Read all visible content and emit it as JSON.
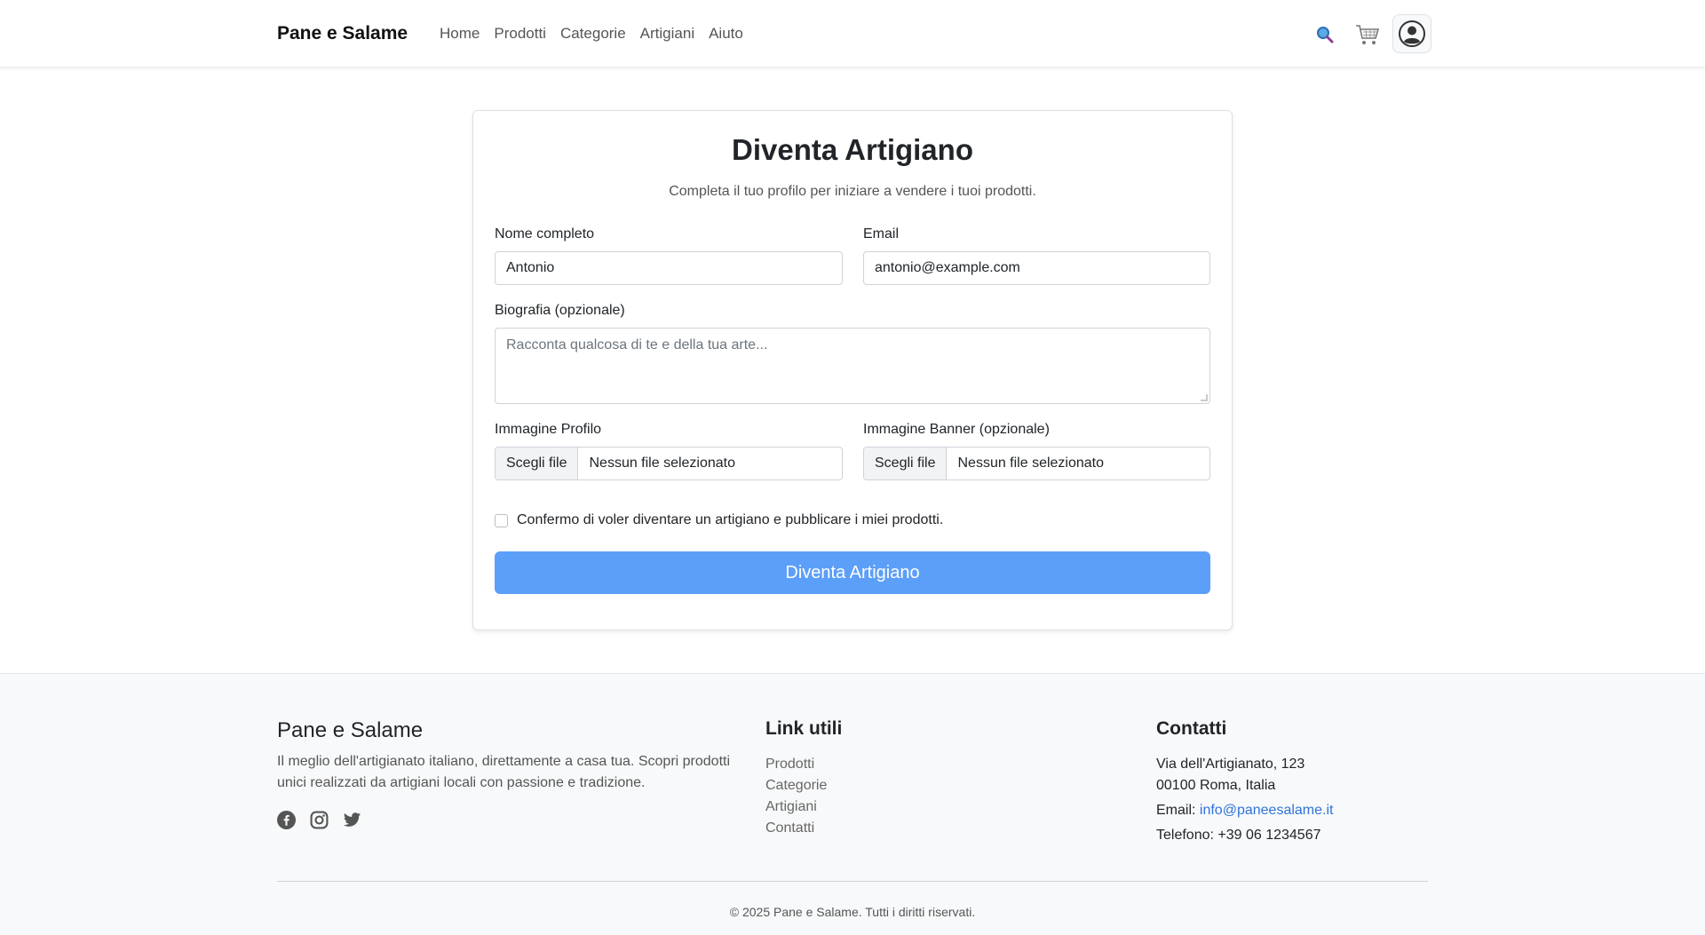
{
  "nav": {
    "brand": "Pane e Salame",
    "links": [
      "Home",
      "Prodotti",
      "Categorie",
      "Artigiani",
      "Aiuto"
    ],
    "icons": [
      "search-icon",
      "cart-icon",
      "user-avatar-icon"
    ]
  },
  "form": {
    "title": "Diventa Artigiano",
    "subtitle": "Completa il tuo profilo per iniziare a vendere i tuoi prodotti.",
    "name_label": "Nome completo",
    "name_value": "Antonio",
    "email_label": "Email",
    "email_value": "antonio@example.com",
    "bio_label": "Biografia (opzionale)",
    "bio_placeholder": "Racconta qualcosa di te e della tua arte...",
    "profile_image_label": "Immagine Profilo",
    "banner_image_label": "Immagine Banner (opzionale)",
    "file_button": "Scegli file",
    "file_none": "Nessun file selezionato",
    "confirm_label": "Confermo di voler diventare un artigiano e pubblicare i miei prodotti.",
    "confirm_checked": false,
    "submit_label": "Diventa Artigiano"
  },
  "footer": {
    "brand": "Pane e Salame",
    "description": "Il meglio dell'artigianato italiano, direttamente a casa tua. Scopri prodotti unici realizzati da artigiani locali con passione e tradizione.",
    "social_icons": [
      "facebook-icon",
      "instagram-icon",
      "twitter-icon"
    ],
    "links_heading": "Link utili",
    "links": [
      "Prodotti",
      "Categorie",
      "Artigiani",
      "Contatti"
    ],
    "contact_heading": "Contatti",
    "address_line1": "Via dell'Artigianato, 123",
    "address_line2": "00100 Roma, Italia",
    "email_prefix": "Email: ",
    "email": "info@paneesalame.it",
    "phone": "Telefono: +39 06 1234567",
    "copyright": "© 2025 Pane e Salame. Tutti i diritti riservati."
  },
  "colors": {
    "accent": "#5c9ff8",
    "link": "#2f73d9",
    "footer_bg": "#f8f9fa"
  }
}
